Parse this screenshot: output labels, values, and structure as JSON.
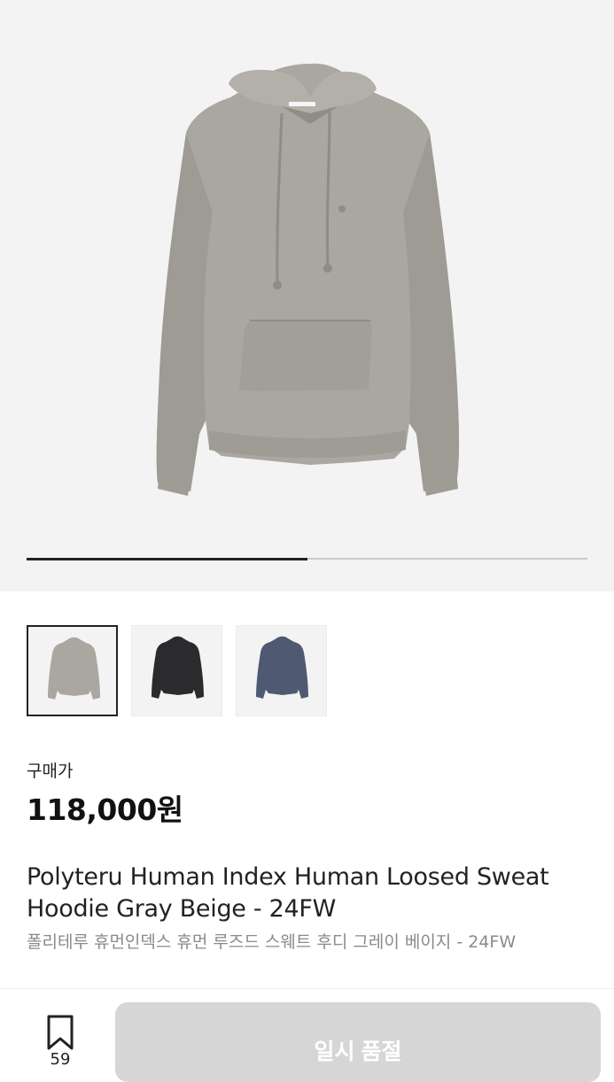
{
  "gallery": {
    "progress_fraction": 0.5,
    "thumbnails": [
      {
        "color_name": "gray-beige",
        "color": "#a9a79f",
        "selected": true
      },
      {
        "color_name": "black",
        "color": "#2b2b2d",
        "selected": false
      },
      {
        "color_name": "navy",
        "color": "#4f5a72",
        "selected": false
      }
    ]
  },
  "product": {
    "price_label": "구매가",
    "price": "118,000원",
    "title_en": "Polyteru Human Index Human Loosed Sweat Hoodie Gray Beige - 24FW",
    "title_ko": "폴리테루 휴먼인덱스 휴먼 루즈드 스웨트 후디 그레이 베이지 - 24FW"
  },
  "bottom_bar": {
    "bookmark_icon": "bookmark-icon",
    "bookmark_count": "59",
    "status_button_label": "일시 품절"
  },
  "colors": {
    "hero_background": "#f3f3f3",
    "disabled_button": "#d6d6d6",
    "accent_text": "#111111"
  }
}
